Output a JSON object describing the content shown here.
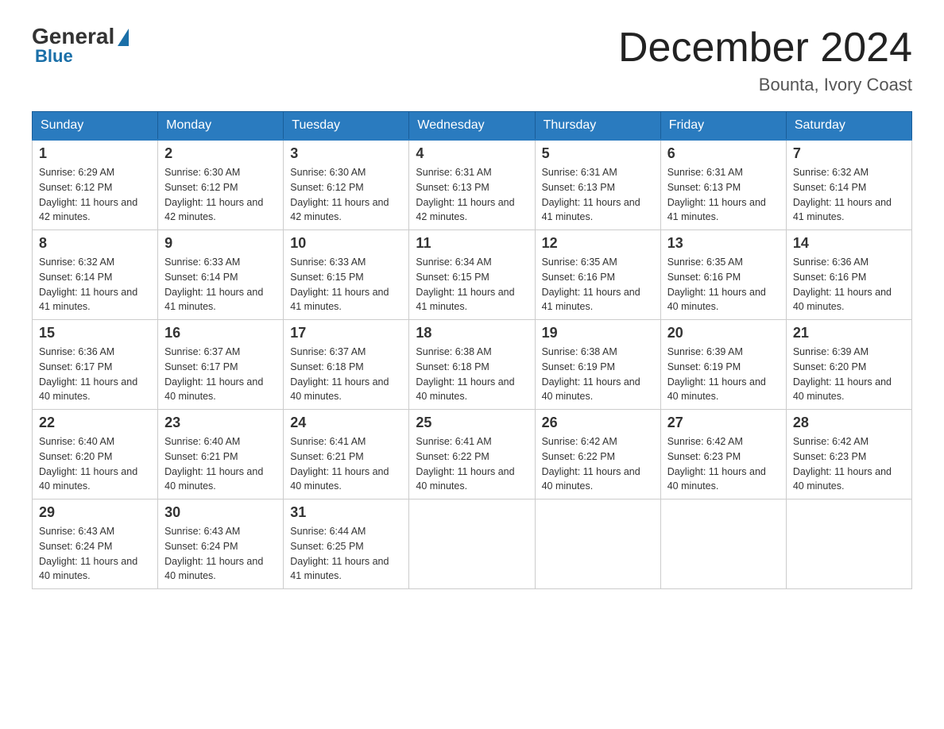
{
  "logo": {
    "general": "General",
    "blue": "Blue"
  },
  "header": {
    "month": "December 2024",
    "location": "Bounta, Ivory Coast"
  },
  "days_of_week": [
    "Sunday",
    "Monday",
    "Tuesday",
    "Wednesday",
    "Thursday",
    "Friday",
    "Saturday"
  ],
  "weeks": [
    [
      {
        "day": "1",
        "sunrise": "6:29 AM",
        "sunset": "6:12 PM",
        "daylight": "11 hours and 42 minutes."
      },
      {
        "day": "2",
        "sunrise": "6:30 AM",
        "sunset": "6:12 PM",
        "daylight": "11 hours and 42 minutes."
      },
      {
        "day": "3",
        "sunrise": "6:30 AM",
        "sunset": "6:12 PM",
        "daylight": "11 hours and 42 minutes."
      },
      {
        "day": "4",
        "sunrise": "6:31 AM",
        "sunset": "6:13 PM",
        "daylight": "11 hours and 42 minutes."
      },
      {
        "day": "5",
        "sunrise": "6:31 AM",
        "sunset": "6:13 PM",
        "daylight": "11 hours and 41 minutes."
      },
      {
        "day": "6",
        "sunrise": "6:31 AM",
        "sunset": "6:13 PM",
        "daylight": "11 hours and 41 minutes."
      },
      {
        "day": "7",
        "sunrise": "6:32 AM",
        "sunset": "6:14 PM",
        "daylight": "11 hours and 41 minutes."
      }
    ],
    [
      {
        "day": "8",
        "sunrise": "6:32 AM",
        "sunset": "6:14 PM",
        "daylight": "11 hours and 41 minutes."
      },
      {
        "day": "9",
        "sunrise": "6:33 AM",
        "sunset": "6:14 PM",
        "daylight": "11 hours and 41 minutes."
      },
      {
        "day": "10",
        "sunrise": "6:33 AM",
        "sunset": "6:15 PM",
        "daylight": "11 hours and 41 minutes."
      },
      {
        "day": "11",
        "sunrise": "6:34 AM",
        "sunset": "6:15 PM",
        "daylight": "11 hours and 41 minutes."
      },
      {
        "day": "12",
        "sunrise": "6:35 AM",
        "sunset": "6:16 PM",
        "daylight": "11 hours and 41 minutes."
      },
      {
        "day": "13",
        "sunrise": "6:35 AM",
        "sunset": "6:16 PM",
        "daylight": "11 hours and 40 minutes."
      },
      {
        "day": "14",
        "sunrise": "6:36 AM",
        "sunset": "6:16 PM",
        "daylight": "11 hours and 40 minutes."
      }
    ],
    [
      {
        "day": "15",
        "sunrise": "6:36 AM",
        "sunset": "6:17 PM",
        "daylight": "11 hours and 40 minutes."
      },
      {
        "day": "16",
        "sunrise": "6:37 AM",
        "sunset": "6:17 PM",
        "daylight": "11 hours and 40 minutes."
      },
      {
        "day": "17",
        "sunrise": "6:37 AM",
        "sunset": "6:18 PM",
        "daylight": "11 hours and 40 minutes."
      },
      {
        "day": "18",
        "sunrise": "6:38 AM",
        "sunset": "6:18 PM",
        "daylight": "11 hours and 40 minutes."
      },
      {
        "day": "19",
        "sunrise": "6:38 AM",
        "sunset": "6:19 PM",
        "daylight": "11 hours and 40 minutes."
      },
      {
        "day": "20",
        "sunrise": "6:39 AM",
        "sunset": "6:19 PM",
        "daylight": "11 hours and 40 minutes."
      },
      {
        "day": "21",
        "sunrise": "6:39 AM",
        "sunset": "6:20 PM",
        "daylight": "11 hours and 40 minutes."
      }
    ],
    [
      {
        "day": "22",
        "sunrise": "6:40 AM",
        "sunset": "6:20 PM",
        "daylight": "11 hours and 40 minutes."
      },
      {
        "day": "23",
        "sunrise": "6:40 AM",
        "sunset": "6:21 PM",
        "daylight": "11 hours and 40 minutes."
      },
      {
        "day": "24",
        "sunrise": "6:41 AM",
        "sunset": "6:21 PM",
        "daylight": "11 hours and 40 minutes."
      },
      {
        "day": "25",
        "sunrise": "6:41 AM",
        "sunset": "6:22 PM",
        "daylight": "11 hours and 40 minutes."
      },
      {
        "day": "26",
        "sunrise": "6:42 AM",
        "sunset": "6:22 PM",
        "daylight": "11 hours and 40 minutes."
      },
      {
        "day": "27",
        "sunrise": "6:42 AM",
        "sunset": "6:23 PM",
        "daylight": "11 hours and 40 minutes."
      },
      {
        "day": "28",
        "sunrise": "6:42 AM",
        "sunset": "6:23 PM",
        "daylight": "11 hours and 40 minutes."
      }
    ],
    [
      {
        "day": "29",
        "sunrise": "6:43 AM",
        "sunset": "6:24 PM",
        "daylight": "11 hours and 40 minutes."
      },
      {
        "day": "30",
        "sunrise": "6:43 AM",
        "sunset": "6:24 PM",
        "daylight": "11 hours and 40 minutes."
      },
      {
        "day": "31",
        "sunrise": "6:44 AM",
        "sunset": "6:25 PM",
        "daylight": "11 hours and 41 minutes."
      },
      null,
      null,
      null,
      null
    ]
  ]
}
